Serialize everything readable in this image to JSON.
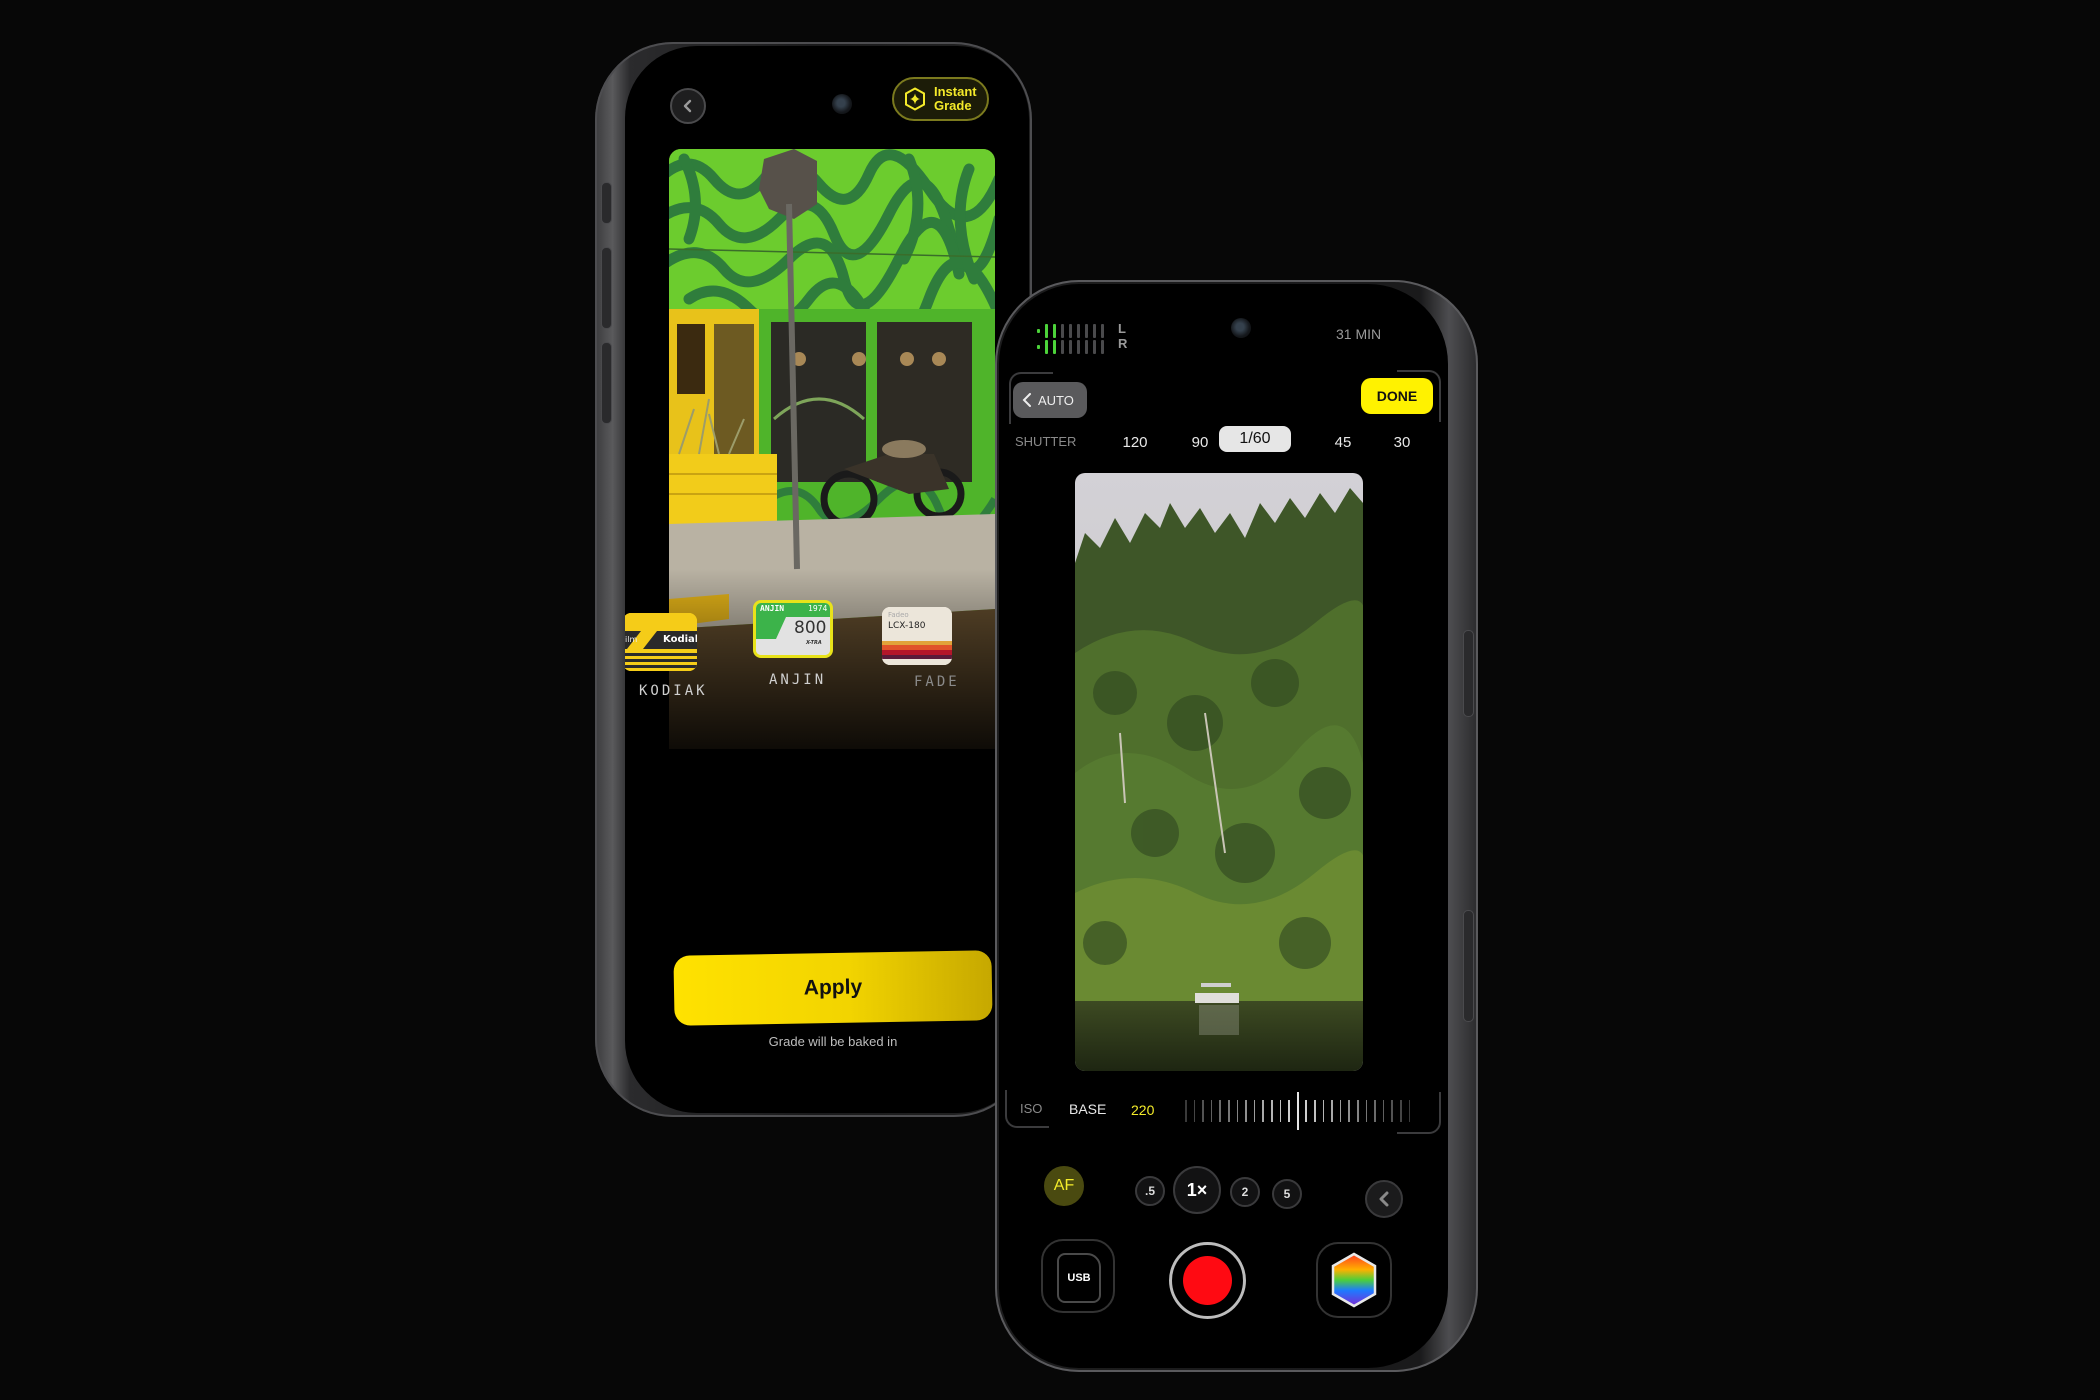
{
  "scene": {
    "background_color": "#070707"
  },
  "phone_left": {
    "screen": "film-grade-picker",
    "back_button_icon": "chevron-left-icon",
    "instant_grade": {
      "icon": "sparkle-hexagon-icon",
      "line1": "Instant",
      "line2": "Grade",
      "color": "#f4ea2a"
    },
    "preview_photo": "Green painted storefront with wavy mural, yellow door and planter, stop sign pole and motorcycle on sidewalk",
    "film_stocks": [
      {
        "name": "KODIAK",
        "card_text": "Kodiak",
        "card_prefix": "ilm",
        "selected": false
      },
      {
        "name": "ANJIN",
        "card_brand": "ANJIN",
        "card_year": "1974",
        "card_iso": "800",
        "card_sub": "X-TRA",
        "selected": true
      },
      {
        "name": "FADE",
        "card_brand": "Fadeo",
        "card_model": "LCX-180",
        "selected": false
      }
    ],
    "apply_label": "Apply",
    "apply_caption": "Grade will be baked in",
    "accent": "#ffe200"
  },
  "phone_right": {
    "screen": "camera-manual-exposure",
    "audio_meter": {
      "channels": [
        "L",
        "R"
      ],
      "active_bars": 3,
      "total_bars": 9
    },
    "recording_time_left": "31 MIN",
    "auto_label": "AUTO",
    "done_label": "DONE",
    "shutter": {
      "label": "SHUTTER",
      "options": [
        "120",
        "90",
        "1/60",
        "45",
        "30"
      ],
      "selected": "1/60"
    },
    "preview_photo": "Forested hillside over a lake with a small pontoon boat at the shoreline",
    "iso": {
      "label": "ISO",
      "mode": "BASE",
      "value": "220"
    },
    "af_label": "AF",
    "zoom_levels": [
      ".5",
      "1×",
      "2",
      "5"
    ],
    "zoom_selected": "1×",
    "storage_label": "USB",
    "record_color": "#ff0a12",
    "done_color": "#fff200"
  }
}
